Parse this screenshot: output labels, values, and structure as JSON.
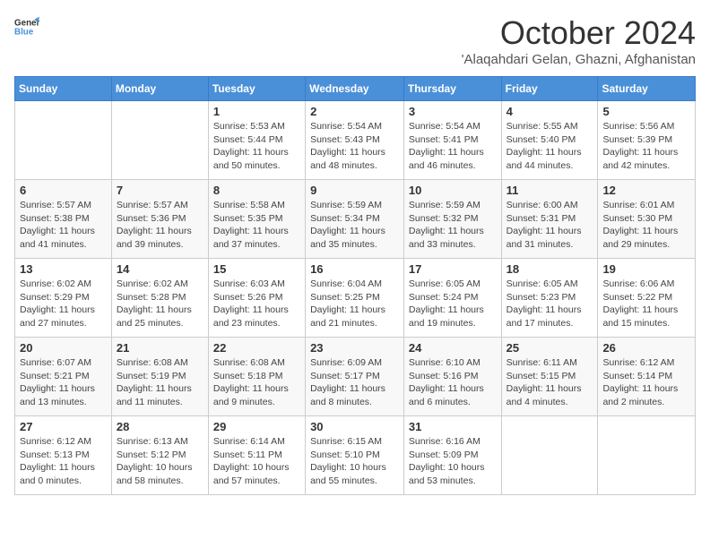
{
  "logo": {
    "line1": "General",
    "line2": "Blue"
  },
  "title": "October 2024",
  "location": "'Alaqahdari Gelan, Ghazni, Afghanistan",
  "weekdays": [
    "Sunday",
    "Monday",
    "Tuesday",
    "Wednesday",
    "Thursday",
    "Friday",
    "Saturday"
  ],
  "weeks": [
    [
      {
        "day": "",
        "sunrise": "",
        "sunset": "",
        "daylight": ""
      },
      {
        "day": "",
        "sunrise": "",
        "sunset": "",
        "daylight": ""
      },
      {
        "day": "1",
        "sunrise": "Sunrise: 5:53 AM",
        "sunset": "Sunset: 5:44 PM",
        "daylight": "Daylight: 11 hours and 50 minutes."
      },
      {
        "day": "2",
        "sunrise": "Sunrise: 5:54 AM",
        "sunset": "Sunset: 5:43 PM",
        "daylight": "Daylight: 11 hours and 48 minutes."
      },
      {
        "day": "3",
        "sunrise": "Sunrise: 5:54 AM",
        "sunset": "Sunset: 5:41 PM",
        "daylight": "Daylight: 11 hours and 46 minutes."
      },
      {
        "day": "4",
        "sunrise": "Sunrise: 5:55 AM",
        "sunset": "Sunset: 5:40 PM",
        "daylight": "Daylight: 11 hours and 44 minutes."
      },
      {
        "day": "5",
        "sunrise": "Sunrise: 5:56 AM",
        "sunset": "Sunset: 5:39 PM",
        "daylight": "Daylight: 11 hours and 42 minutes."
      }
    ],
    [
      {
        "day": "6",
        "sunrise": "Sunrise: 5:57 AM",
        "sunset": "Sunset: 5:38 PM",
        "daylight": "Daylight: 11 hours and 41 minutes."
      },
      {
        "day": "7",
        "sunrise": "Sunrise: 5:57 AM",
        "sunset": "Sunset: 5:36 PM",
        "daylight": "Daylight: 11 hours and 39 minutes."
      },
      {
        "day": "8",
        "sunrise": "Sunrise: 5:58 AM",
        "sunset": "Sunset: 5:35 PM",
        "daylight": "Daylight: 11 hours and 37 minutes."
      },
      {
        "day": "9",
        "sunrise": "Sunrise: 5:59 AM",
        "sunset": "Sunset: 5:34 PM",
        "daylight": "Daylight: 11 hours and 35 minutes."
      },
      {
        "day": "10",
        "sunrise": "Sunrise: 5:59 AM",
        "sunset": "Sunset: 5:32 PM",
        "daylight": "Daylight: 11 hours and 33 minutes."
      },
      {
        "day": "11",
        "sunrise": "Sunrise: 6:00 AM",
        "sunset": "Sunset: 5:31 PM",
        "daylight": "Daylight: 11 hours and 31 minutes."
      },
      {
        "day": "12",
        "sunrise": "Sunrise: 6:01 AM",
        "sunset": "Sunset: 5:30 PM",
        "daylight": "Daylight: 11 hours and 29 minutes."
      }
    ],
    [
      {
        "day": "13",
        "sunrise": "Sunrise: 6:02 AM",
        "sunset": "Sunset: 5:29 PM",
        "daylight": "Daylight: 11 hours and 27 minutes."
      },
      {
        "day": "14",
        "sunrise": "Sunrise: 6:02 AM",
        "sunset": "Sunset: 5:28 PM",
        "daylight": "Daylight: 11 hours and 25 minutes."
      },
      {
        "day": "15",
        "sunrise": "Sunrise: 6:03 AM",
        "sunset": "Sunset: 5:26 PM",
        "daylight": "Daylight: 11 hours and 23 minutes."
      },
      {
        "day": "16",
        "sunrise": "Sunrise: 6:04 AM",
        "sunset": "Sunset: 5:25 PM",
        "daylight": "Daylight: 11 hours and 21 minutes."
      },
      {
        "day": "17",
        "sunrise": "Sunrise: 6:05 AM",
        "sunset": "Sunset: 5:24 PM",
        "daylight": "Daylight: 11 hours and 19 minutes."
      },
      {
        "day": "18",
        "sunrise": "Sunrise: 6:05 AM",
        "sunset": "Sunset: 5:23 PM",
        "daylight": "Daylight: 11 hours and 17 minutes."
      },
      {
        "day": "19",
        "sunrise": "Sunrise: 6:06 AM",
        "sunset": "Sunset: 5:22 PM",
        "daylight": "Daylight: 11 hours and 15 minutes."
      }
    ],
    [
      {
        "day": "20",
        "sunrise": "Sunrise: 6:07 AM",
        "sunset": "Sunset: 5:21 PM",
        "daylight": "Daylight: 11 hours and 13 minutes."
      },
      {
        "day": "21",
        "sunrise": "Sunrise: 6:08 AM",
        "sunset": "Sunset: 5:19 PM",
        "daylight": "Daylight: 11 hours and 11 minutes."
      },
      {
        "day": "22",
        "sunrise": "Sunrise: 6:08 AM",
        "sunset": "Sunset: 5:18 PM",
        "daylight": "Daylight: 11 hours and 9 minutes."
      },
      {
        "day": "23",
        "sunrise": "Sunrise: 6:09 AM",
        "sunset": "Sunset: 5:17 PM",
        "daylight": "Daylight: 11 hours and 8 minutes."
      },
      {
        "day": "24",
        "sunrise": "Sunrise: 6:10 AM",
        "sunset": "Sunset: 5:16 PM",
        "daylight": "Daylight: 11 hours and 6 minutes."
      },
      {
        "day": "25",
        "sunrise": "Sunrise: 6:11 AM",
        "sunset": "Sunset: 5:15 PM",
        "daylight": "Daylight: 11 hours and 4 minutes."
      },
      {
        "day": "26",
        "sunrise": "Sunrise: 6:12 AM",
        "sunset": "Sunset: 5:14 PM",
        "daylight": "Daylight: 11 hours and 2 minutes."
      }
    ],
    [
      {
        "day": "27",
        "sunrise": "Sunrise: 6:12 AM",
        "sunset": "Sunset: 5:13 PM",
        "daylight": "Daylight: 11 hours and 0 minutes."
      },
      {
        "day": "28",
        "sunrise": "Sunrise: 6:13 AM",
        "sunset": "Sunset: 5:12 PM",
        "daylight": "Daylight: 10 hours and 58 minutes."
      },
      {
        "day": "29",
        "sunrise": "Sunrise: 6:14 AM",
        "sunset": "Sunset: 5:11 PM",
        "daylight": "Daylight: 10 hours and 57 minutes."
      },
      {
        "day": "30",
        "sunrise": "Sunrise: 6:15 AM",
        "sunset": "Sunset: 5:10 PM",
        "daylight": "Daylight: 10 hours and 55 minutes."
      },
      {
        "day": "31",
        "sunrise": "Sunrise: 6:16 AM",
        "sunset": "Sunset: 5:09 PM",
        "daylight": "Daylight: 10 hours and 53 minutes."
      },
      {
        "day": "",
        "sunrise": "",
        "sunset": "",
        "daylight": ""
      },
      {
        "day": "",
        "sunrise": "",
        "sunset": "",
        "daylight": ""
      }
    ]
  ]
}
